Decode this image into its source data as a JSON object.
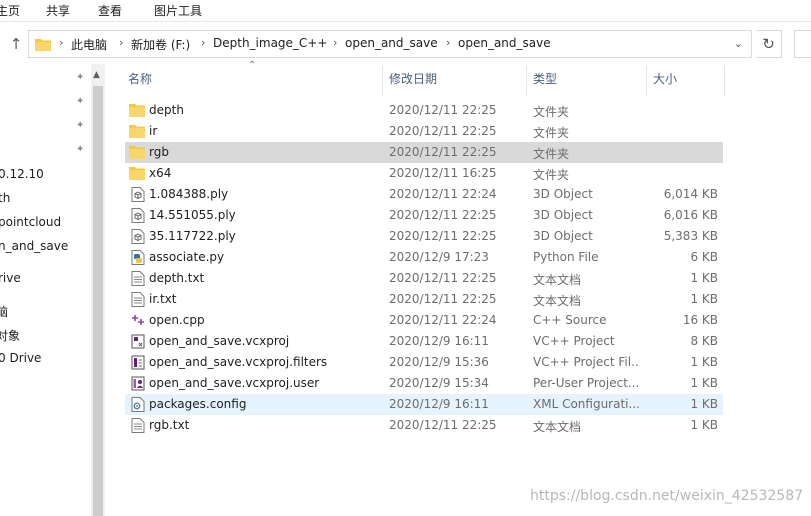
{
  "ribbon": {
    "tabs": [
      "主页",
      "共享",
      "查看",
      "图片工具"
    ]
  },
  "address": {
    "segments": [
      "此电脑",
      "新加卷 (F:)",
      "Depth_image_C++",
      "open_and_save",
      "open_and_save"
    ],
    "dropdown_icon": "chevron-down-icon",
    "refresh_icon": "refresh-icon"
  },
  "nav": {
    "items": [
      "0.12.10",
      "th",
      "pointcloud",
      "n_and_save",
      "rive",
      "脑",
      "对象",
      "0 Drive"
    ]
  },
  "columns": {
    "name": "名称",
    "date": "修改日期",
    "type": "类型",
    "size": "大小"
  },
  "files": [
    {
      "name": "depth",
      "date": "2020/12/11 22:25",
      "type": "文件夹",
      "size": "",
      "icon": "folder-icon"
    },
    {
      "name": "ir",
      "date": "2020/12/11 22:25",
      "type": "文件夹",
      "size": "",
      "icon": "folder-icon"
    },
    {
      "name": "rgb",
      "date": "2020/12/11 22:25",
      "type": "文件夹",
      "size": "",
      "icon": "folder-icon"
    },
    {
      "name": "x64",
      "date": "2020/12/11 16:25",
      "type": "文件夹",
      "size": "",
      "icon": "folder-icon"
    },
    {
      "name": "1.084388.ply",
      "date": "2020/12/11 22:24",
      "type": "3D Object",
      "size": "6,014 KB",
      "icon": "3d-object-icon"
    },
    {
      "name": "14.551055.ply",
      "date": "2020/12/11 22:25",
      "type": "3D Object",
      "size": "6,016 KB",
      "icon": "3d-object-icon"
    },
    {
      "name": "35.117722.ply",
      "date": "2020/12/11 22:25",
      "type": "3D Object",
      "size": "5,383 KB",
      "icon": "3d-object-icon"
    },
    {
      "name": "associate.py",
      "date": "2020/12/9 17:23",
      "type": "Python File",
      "size": "6 KB",
      "icon": "python-file-icon"
    },
    {
      "name": "depth.txt",
      "date": "2020/12/11 22:25",
      "type": "文本文档",
      "size": "1 KB",
      "icon": "text-file-icon"
    },
    {
      "name": "ir.txt",
      "date": "2020/12/11 22:25",
      "type": "文本文档",
      "size": "1 KB",
      "icon": "text-file-icon"
    },
    {
      "name": "open.cpp",
      "date": "2020/12/11 22:24",
      "type": "C++ Source",
      "size": "16 KB",
      "icon": "cpp-file-icon"
    },
    {
      "name": "open_and_save.vcxproj",
      "date": "2020/12/9 16:11",
      "type": "VC++ Project",
      "size": "8 KB",
      "icon": "vcxproj-file-icon"
    },
    {
      "name": "open_and_save.vcxproj.filters",
      "date": "2020/12/9 15:36",
      "type": "VC++ Project Fil...",
      "size": "1 KB",
      "icon": "filters-file-icon"
    },
    {
      "name": "open_and_save.vcxproj.user",
      "date": "2020/12/9 15:34",
      "type": "Per-User Project...",
      "size": "1 KB",
      "icon": "user-file-icon"
    },
    {
      "name": "packages.config",
      "date": "2020/12/9 16:11",
      "type": "XML Configurati...",
      "size": "1 KB",
      "icon": "config-file-icon"
    },
    {
      "name": "rgb.txt",
      "date": "2020/12/11 22:25",
      "type": "文本文档",
      "size": "1 KB",
      "icon": "text-file-icon"
    }
  ],
  "selected_file": "rgb",
  "hovered_file": "packages.config",
  "watermark": "https://blog.csdn.net/weixin_42532587",
  "colors": {
    "folder": "#f5c842",
    "selection": "#d9d9d9",
    "hover": "#e5f3ff",
    "header_text": "#4c607a"
  }
}
